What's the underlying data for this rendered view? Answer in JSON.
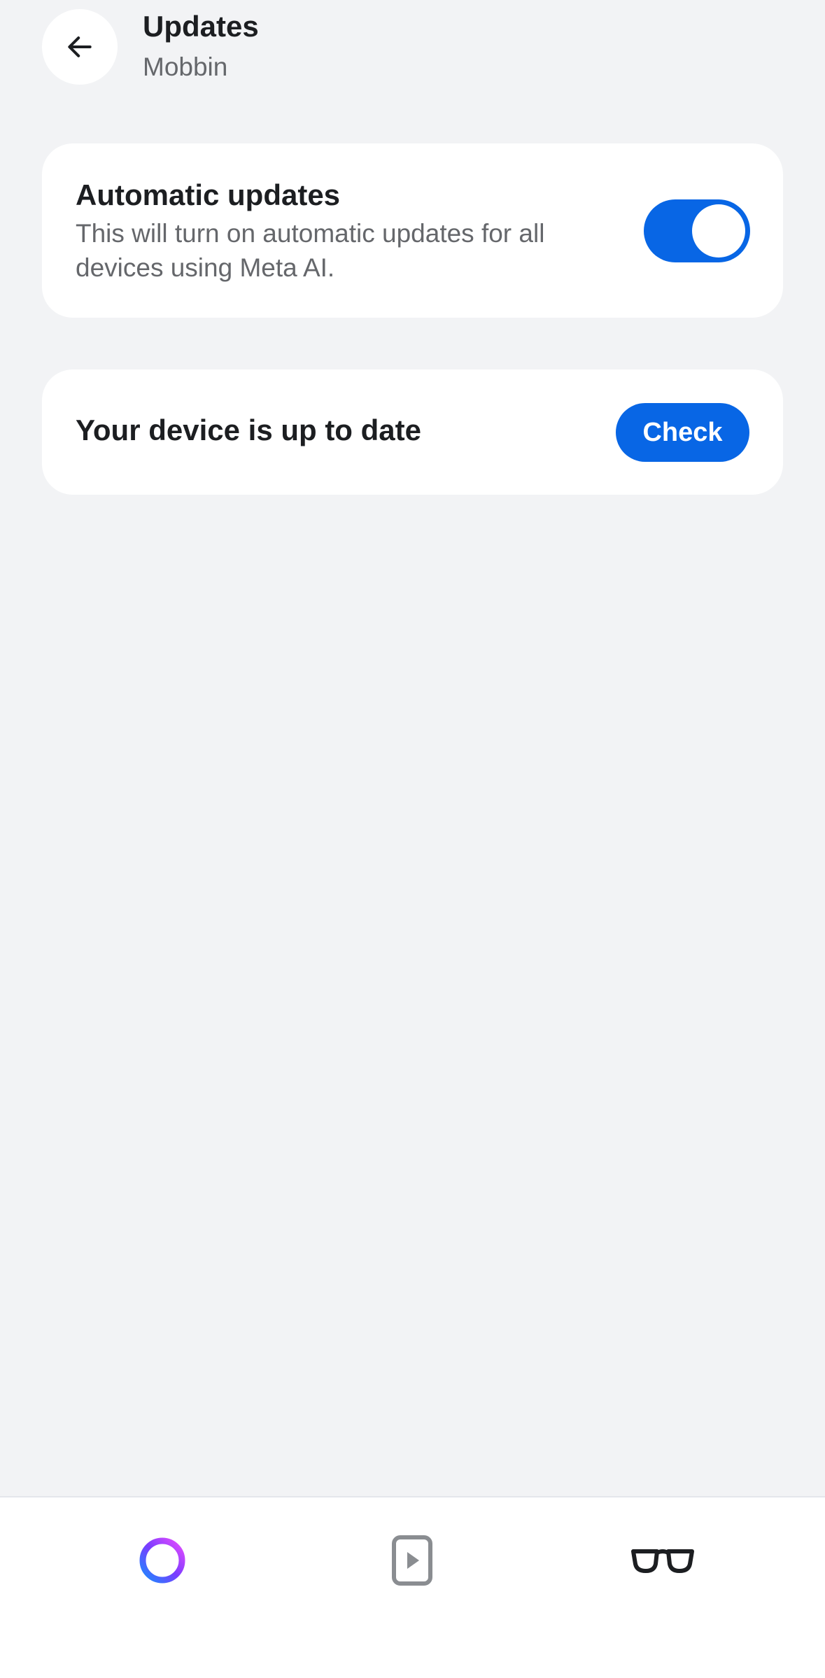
{
  "header": {
    "title": "Updates",
    "subtitle": "Mobbin",
    "back_icon": "arrow-left-icon"
  },
  "auto_updates": {
    "title": "Automatic updates",
    "description": "This will turn on automatic updates for all devices using Meta AI.",
    "enabled": true
  },
  "status": {
    "text": "Your device is up to date",
    "check_label": "Check"
  },
  "bottom_nav": {
    "items": [
      {
        "icon": "meta-ai-ring-icon"
      },
      {
        "icon": "media-play-icon"
      },
      {
        "icon": "glasses-icon"
      }
    ]
  },
  "colors": {
    "accent": "#0866e5",
    "background": "#f2f3f5",
    "card": "#ffffff",
    "text_primary": "#1c1e21",
    "text_secondary": "#65676b"
  }
}
